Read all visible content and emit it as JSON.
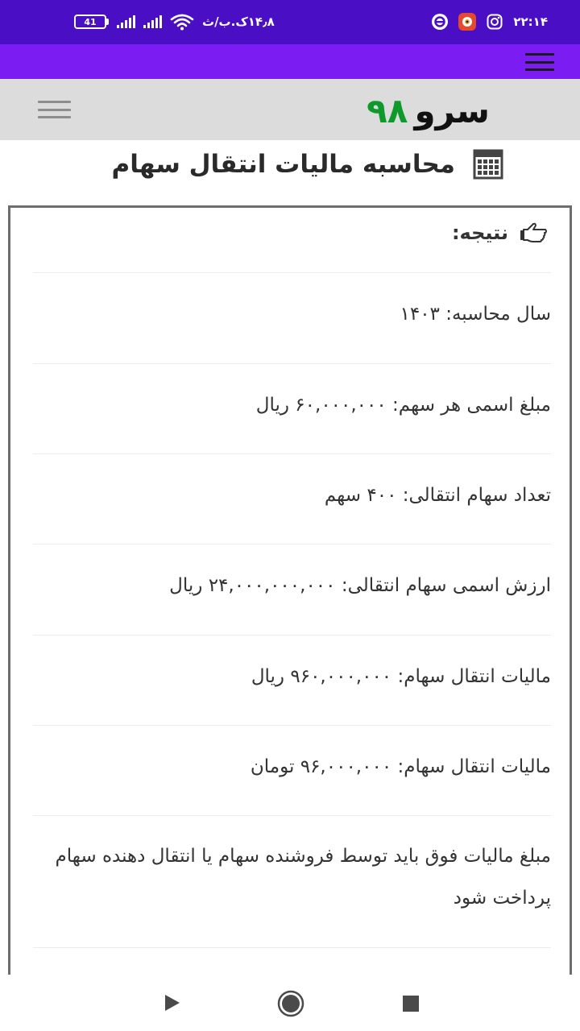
{
  "status_bar": {
    "time": "۲۲:۱۴",
    "network_speed": "۱۴٫۸ک.ب/ث",
    "battery_level": "41",
    "icons": [
      "instagram-icon",
      "app-notification-icon",
      "browser-icon",
      "wifi-icon",
      "signal-icon",
      "battery-icon"
    ]
  },
  "header": {
    "logo_word": "سرو",
    "logo_number": "۹۸",
    "logo_number_color": "#0e9a2a",
    "menu_icon": "hamburger-icon"
  },
  "page": {
    "title": "محاسبه مالیات انتقال سهام",
    "title_icon": "calculator-icon"
  },
  "result": {
    "heading": "نتیجه:",
    "heading_icon": "hand-pointer-icon",
    "rows": [
      "سال محاسبه: ۱۴۰۳",
      "مبلغ اسمی هر سهم: ۶۰,۰۰۰,۰۰۰ ریال",
      "تعداد سهام انتقالی: ۴۰۰ سهم",
      "ارزش اسمی سهام انتقالی: ۲۴,۰۰۰,۰۰۰,۰۰۰ ریال",
      "مالیات انتقال سهام: ۹۶۰,۰۰۰,۰۰۰ ریال",
      "مالیات انتقال سهام: ۹۶,۰۰۰,۰۰۰ تومان"
    ],
    "note": "مبلغ مالیات فوق باید توسط فروشنده سهام یا انتقال دهنده سهام پرداخت شود"
  },
  "colors": {
    "status_bar": "#4a0fc4",
    "accent_bar": "#7a1cf2",
    "header_bg": "#dcdcdc"
  },
  "nav_bar": {
    "icons": [
      "back-icon",
      "home-icon",
      "recents-icon"
    ]
  }
}
